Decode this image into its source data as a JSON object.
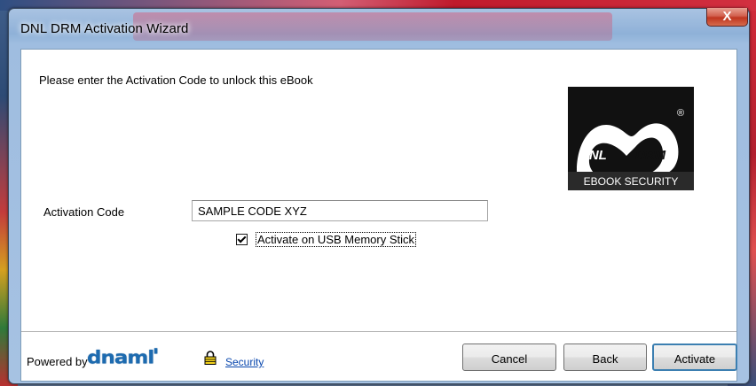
{
  "window": {
    "title": "DNL DRM Activation Wizard",
    "close_label": "X"
  },
  "main": {
    "instruction": "Please enter the Activation Code to unlock this eBook",
    "logo": {
      "left_text": "DNL",
      "right_text": "DRM",
      "registered": "®",
      "tagline": "EBOOK SECURITY"
    },
    "activation_code_label": "Activation Code",
    "activation_code_value": "SAMPLE CODE XYZ",
    "usb_checkbox_label": "Activate on USB Memory Stick",
    "usb_checkbox_checked": true
  },
  "footer": {
    "powered_by": "Powered by",
    "brand": "dnaml",
    "security_link": "Security",
    "buttons": {
      "cancel": "Cancel",
      "back": "Back",
      "activate": "Activate"
    }
  },
  "colors": {
    "brand_blue": "#1d6bb0",
    "link_blue": "#0645ad",
    "default_button_border": "#3c7fb1"
  }
}
